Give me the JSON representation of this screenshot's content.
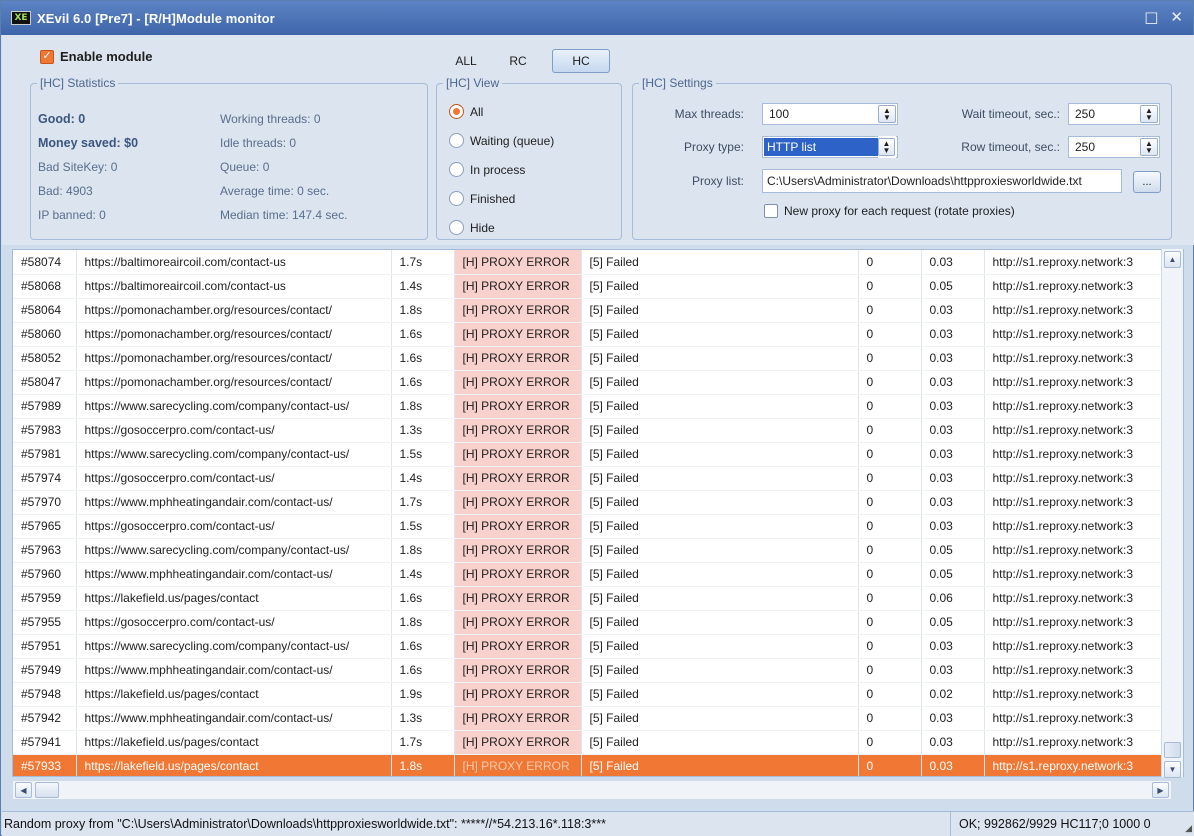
{
  "window": {
    "logo": "XE",
    "title": "XEvil 6.0 [Pre7] - [R/H]Module monitor",
    "restore_icon": "□",
    "close_icon": "✕"
  },
  "module": {
    "enable_label": "Enable module",
    "enabled": true
  },
  "view_tabs": [
    {
      "label": "ALL",
      "active": false
    },
    {
      "label": "RC",
      "active": false
    },
    {
      "label": "HC",
      "active": true
    }
  ],
  "statistics": {
    "legend": "[HC] Statistics",
    "good": "Good: 0",
    "money_saved": "Money saved: $0",
    "bad_sitekey": "Bad SiteKey: 0",
    "bad": "Bad: 4903",
    "ip_banned": "IP banned: 0",
    "working_threads": "Working threads: 0",
    "idle_threads": "Idle threads: 0",
    "queue": "Queue: 0",
    "average_time": "Average time: 0 sec.",
    "median_time": "Median time: 147.4 sec."
  },
  "hc_view": {
    "legend": "[HC] View",
    "options": [
      {
        "label": "All",
        "selected": true
      },
      {
        "label": "Waiting (queue)",
        "selected": false
      },
      {
        "label": "In process",
        "selected": false
      },
      {
        "label": "Finished",
        "selected": false
      },
      {
        "label": "Hide",
        "selected": false
      }
    ]
  },
  "hc_settings": {
    "legend": "[HC] Settings",
    "max_threads_label": "Max threads:",
    "max_threads": "100",
    "wait_timeout_label": "Wait timeout, sec.:",
    "wait_timeout": "250",
    "proxy_type_label": "Proxy type:",
    "proxy_type": "HTTP list",
    "row_timeout_label": "Row timeout, sec.:",
    "row_timeout": "250",
    "proxy_list_label": "Proxy list:",
    "proxy_list": "C:\\Users\\Administrator\\Downloads\\httpproxiesworldwide.txt",
    "browse_label": "...",
    "rotate_label": "New proxy for each request (rotate proxies)",
    "rotate_checked": false
  },
  "grid": {
    "rows": [
      {
        "id": "#58074",
        "url": "https://baltimoreaircoil.com/contact-us",
        "time": "1.7s",
        "status": "[H] PROXY ERROR",
        "result": "[5] Failed",
        "count": "0",
        "score": "0.03",
        "proxy": "http://s1.reproxy.network:3"
      },
      {
        "id": "#58068",
        "url": "https://baltimoreaircoil.com/contact-us",
        "time": "1.4s",
        "status": "[H] PROXY ERROR",
        "result": "[5] Failed",
        "count": "0",
        "score": "0.05",
        "proxy": "http://s1.reproxy.network:3"
      },
      {
        "id": "#58064",
        "url": "https://pomonachamber.org/resources/contact/",
        "time": "1.8s",
        "status": "[H] PROXY ERROR",
        "result": "[5] Failed",
        "count": "0",
        "score": "0.03",
        "proxy": "http://s1.reproxy.network:3"
      },
      {
        "id": "#58060",
        "url": "https://pomonachamber.org/resources/contact/",
        "time": "1.6s",
        "status": "[H] PROXY ERROR",
        "result": "[5] Failed",
        "count": "0",
        "score": "0.03",
        "proxy": "http://s1.reproxy.network:3"
      },
      {
        "id": "#58052",
        "url": "https://pomonachamber.org/resources/contact/",
        "time": "1.6s",
        "status": "[H] PROXY ERROR",
        "result": "[5] Failed",
        "count": "0",
        "score": "0.03",
        "proxy": "http://s1.reproxy.network:3"
      },
      {
        "id": "#58047",
        "url": "https://pomonachamber.org/resources/contact/",
        "time": "1.6s",
        "status": "[H] PROXY ERROR",
        "result": "[5] Failed",
        "count": "0",
        "score": "0.03",
        "proxy": "http://s1.reproxy.network:3"
      },
      {
        "id": "#57989",
        "url": "https://www.sarecycling.com/company/contact-us/",
        "time": "1.8s",
        "status": "[H] PROXY ERROR",
        "result": "[5] Failed",
        "count": "0",
        "score": "0.03",
        "proxy": "http://s1.reproxy.network:3"
      },
      {
        "id": "#57983",
        "url": "https://gosoccerpro.com/contact-us/",
        "time": "1.3s",
        "status": "[H] PROXY ERROR",
        "result": "[5] Failed",
        "count": "0",
        "score": "0.03",
        "proxy": "http://s1.reproxy.network:3"
      },
      {
        "id": "#57981",
        "url": "https://www.sarecycling.com/company/contact-us/",
        "time": "1.5s",
        "status": "[H] PROXY ERROR",
        "result": "[5] Failed",
        "count": "0",
        "score": "0.03",
        "proxy": "http://s1.reproxy.network:3"
      },
      {
        "id": "#57974",
        "url": "https://gosoccerpro.com/contact-us/",
        "time": "1.4s",
        "status": "[H] PROXY ERROR",
        "result": "[5] Failed",
        "count": "0",
        "score": "0.03",
        "proxy": "http://s1.reproxy.network:3"
      },
      {
        "id": "#57970",
        "url": "https://www.mphheatingandair.com/contact-us/",
        "time": "1.7s",
        "status": "[H] PROXY ERROR",
        "result": "[5] Failed",
        "count": "0",
        "score": "0.03",
        "proxy": "http://s1.reproxy.network:3"
      },
      {
        "id": "#57965",
        "url": "https://gosoccerpro.com/contact-us/",
        "time": "1.5s",
        "status": "[H] PROXY ERROR",
        "result": "[5] Failed",
        "count": "0",
        "score": "0.03",
        "proxy": "http://s1.reproxy.network:3"
      },
      {
        "id": "#57963",
        "url": "https://www.sarecycling.com/company/contact-us/",
        "time": "1.8s",
        "status": "[H] PROXY ERROR",
        "result": "[5] Failed",
        "count": "0",
        "score": "0.05",
        "proxy": "http://s1.reproxy.network:3"
      },
      {
        "id": "#57960",
        "url": "https://www.mphheatingandair.com/contact-us/",
        "time": "1.4s",
        "status": "[H] PROXY ERROR",
        "result": "[5] Failed",
        "count": "0",
        "score": "0.05",
        "proxy": "http://s1.reproxy.network:3"
      },
      {
        "id": "#57959",
        "url": "https://lakefield.us/pages/contact",
        "time": "1.6s",
        "status": "[H] PROXY ERROR",
        "result": "[5] Failed",
        "count": "0",
        "score": "0.06",
        "proxy": "http://s1.reproxy.network:3"
      },
      {
        "id": "#57955",
        "url": "https://gosoccerpro.com/contact-us/",
        "time": "1.8s",
        "status": "[H] PROXY ERROR",
        "result": "[5] Failed",
        "count": "0",
        "score": "0.05",
        "proxy": "http://s1.reproxy.network:3"
      },
      {
        "id": "#57951",
        "url": "https://www.sarecycling.com/company/contact-us/",
        "time": "1.6s",
        "status": "[H] PROXY ERROR",
        "result": "[5] Failed",
        "count": "0",
        "score": "0.03",
        "proxy": "http://s1.reproxy.network:3"
      },
      {
        "id": "#57949",
        "url": "https://www.mphheatingandair.com/contact-us/",
        "time": "1.6s",
        "status": "[H] PROXY ERROR",
        "result": "[5] Failed",
        "count": "0",
        "score": "0.03",
        "proxy": "http://s1.reproxy.network:3"
      },
      {
        "id": "#57948",
        "url": "https://lakefield.us/pages/contact",
        "time": "1.9s",
        "status": "[H] PROXY ERROR",
        "result": "[5] Failed",
        "count": "0",
        "score": "0.02",
        "proxy": "http://s1.reproxy.network:3"
      },
      {
        "id": "#57942",
        "url": "https://www.mphheatingandair.com/contact-us/",
        "time": "1.3s",
        "status": "[H] PROXY ERROR",
        "result": "[5] Failed",
        "count": "0",
        "score": "0.03",
        "proxy": "http://s1.reproxy.network:3"
      },
      {
        "id": "#57941",
        "url": "https://lakefield.us/pages/contact",
        "time": "1.7s",
        "status": "[H] PROXY ERROR",
        "result": "[5] Failed",
        "count": "0",
        "score": "0.03",
        "proxy": "http://s1.reproxy.network:3"
      },
      {
        "id": "#57933",
        "url": "https://lakefield.us/pages/contact",
        "time": "1.8s",
        "status": "[H] PROXY ERROR",
        "result": "[5] Failed",
        "count": "0",
        "score": "0.03",
        "proxy": "http://s1.reproxy.network:3",
        "selected": true
      }
    ]
  },
  "statusbar": {
    "left": "Random proxy from \"C:\\Users\\Administrator\\Downloads\\httpproxiesworldwide.txt\": *****//*54.213.16*.118:3***",
    "right": "OK; 992862/9929 HC117;0 1000 0"
  },
  "colors": {
    "accent": "#f07834",
    "error_cell": "#f8d0cc",
    "titlebar": "#4a72b6",
    "panel": "#dbe4ef"
  }
}
